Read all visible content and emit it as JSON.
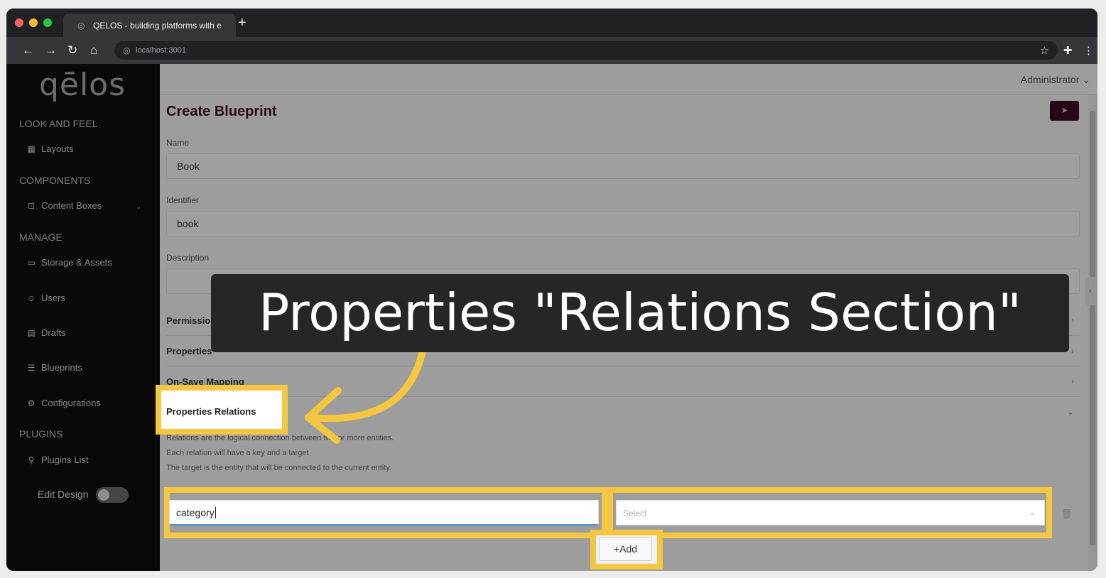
{
  "browser": {
    "tab_title": "QELOS - building platforms with e",
    "new_tab": "+",
    "url": "localhost:3001"
  },
  "sidebar": {
    "logo": "qēlos",
    "sections": [
      {
        "title": "LOOK AND FEEL",
        "items": [
          {
            "label": "Layouts",
            "icon": "grid-icon"
          }
        ]
      },
      {
        "title": "COMPONENTS",
        "items": [
          {
            "label": "Content Boxes",
            "icon": "box-icon"
          }
        ]
      },
      {
        "title": "MANAGE",
        "items": [
          {
            "label": "Storage & Assets",
            "icon": "storage-icon"
          },
          {
            "label": "Users",
            "icon": "user-icon"
          },
          {
            "label": "Drafts",
            "icon": "drafts-icon"
          },
          {
            "label": "Blueprints",
            "icon": "database-icon"
          },
          {
            "label": "Configurations",
            "icon": "gear-icon"
          }
        ]
      },
      {
        "title": "PLUGINS",
        "items": [
          {
            "label": "Plugins List",
            "icon": "plug-icon"
          }
        ]
      }
    ],
    "edit_design": "Edit Design"
  },
  "header": {
    "user": "Administrator"
  },
  "form": {
    "title": "Create Blueprint",
    "name_label": "Name",
    "name_value": "Book",
    "identifier_label": "Identifier",
    "identifier_value": "book",
    "description_label": "Description",
    "sections": [
      "Permissions and Roles",
      "Properties",
      "On-Save Mapping",
      "Properties Relations"
    ],
    "relations_desc": [
      "Relations are the logical connection between two or more entities.",
      "Each relation will have a key and a target",
      "The target is the entity that will be connected to the current entity."
    ],
    "key_value": "category",
    "target_placeholder": "Select",
    "add_label": "+Add"
  },
  "overlay": {
    "caption": "Properties \"Relations Section\""
  },
  "colors": {
    "highlight": "#f5c741",
    "brand": "#3b0b24",
    "sidebar_bg": "#0e0e0e"
  }
}
